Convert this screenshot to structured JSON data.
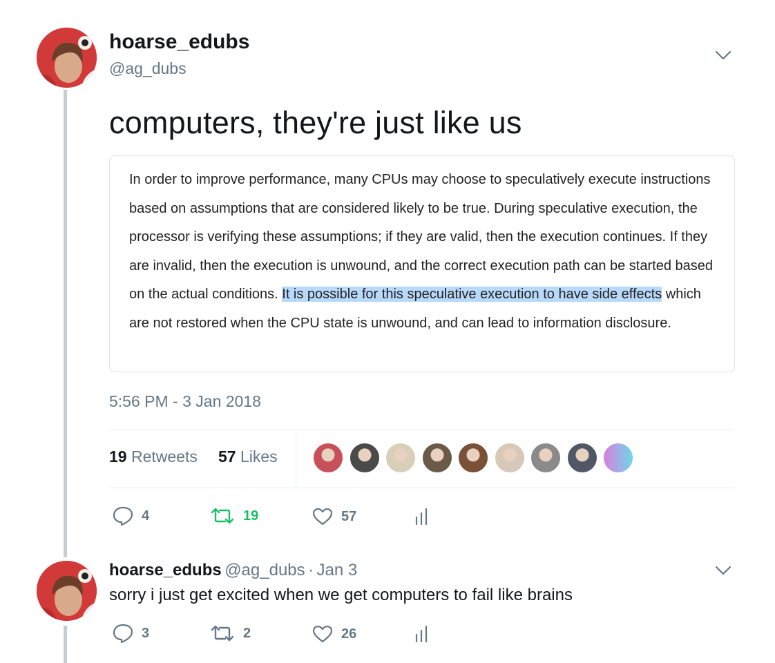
{
  "tweet": {
    "display_name": "hoarse_edubs",
    "handle": "@ag_dubs",
    "text": "computers, they're just like us",
    "quote": {
      "before": "In order to improve performance, many CPUs may choose to speculatively execute instructions based on assumptions that are considered likely to be true. During speculative execution, the processor is verifying these assumptions; if they are valid, then the execution continues. If they are invalid, then the execution is unwound, and the correct execution path can be started based on the actual conditions. ",
      "highlighted": "It is possible for this speculative execution to have side effects",
      "after": " which are not restored when the CPU state is unwound, and can lead to information disclosure."
    },
    "timestamp": "5:56 PM - 3 Jan 2018",
    "stats": {
      "retweets_count": "19",
      "retweets_label": "Retweets",
      "likes_count": "57",
      "likes_label": "Likes"
    },
    "actions": {
      "replies": "4",
      "retweets": "19",
      "likes": "57"
    },
    "likers_colors": [
      "#c8505a",
      "#4a4a4a",
      "#d8cfb8",
      "#6b5a48",
      "#7a5036",
      "#d8c8b8",
      "#8a8a8a",
      "#505868",
      "#d77fe0"
    ]
  },
  "reply": {
    "display_name": "hoarse_edubs",
    "handle": "@ag_dubs",
    "separator": "·",
    "date": "Jan 3",
    "text": "sorry i just get excited when we get computers to fail like brains",
    "actions": {
      "replies": "3",
      "retweets": "2",
      "likes": "26"
    }
  },
  "colors": {
    "retweet_active": "#17bf63",
    "highlight": "#b9d9fb",
    "muted": "#657786"
  },
  "icons": {
    "reply": "speech-bubble-icon",
    "retweet": "retweet-arrows-icon",
    "like": "heart-icon",
    "analytics": "bar-chart-icon",
    "menu": "chevron-down-icon"
  }
}
